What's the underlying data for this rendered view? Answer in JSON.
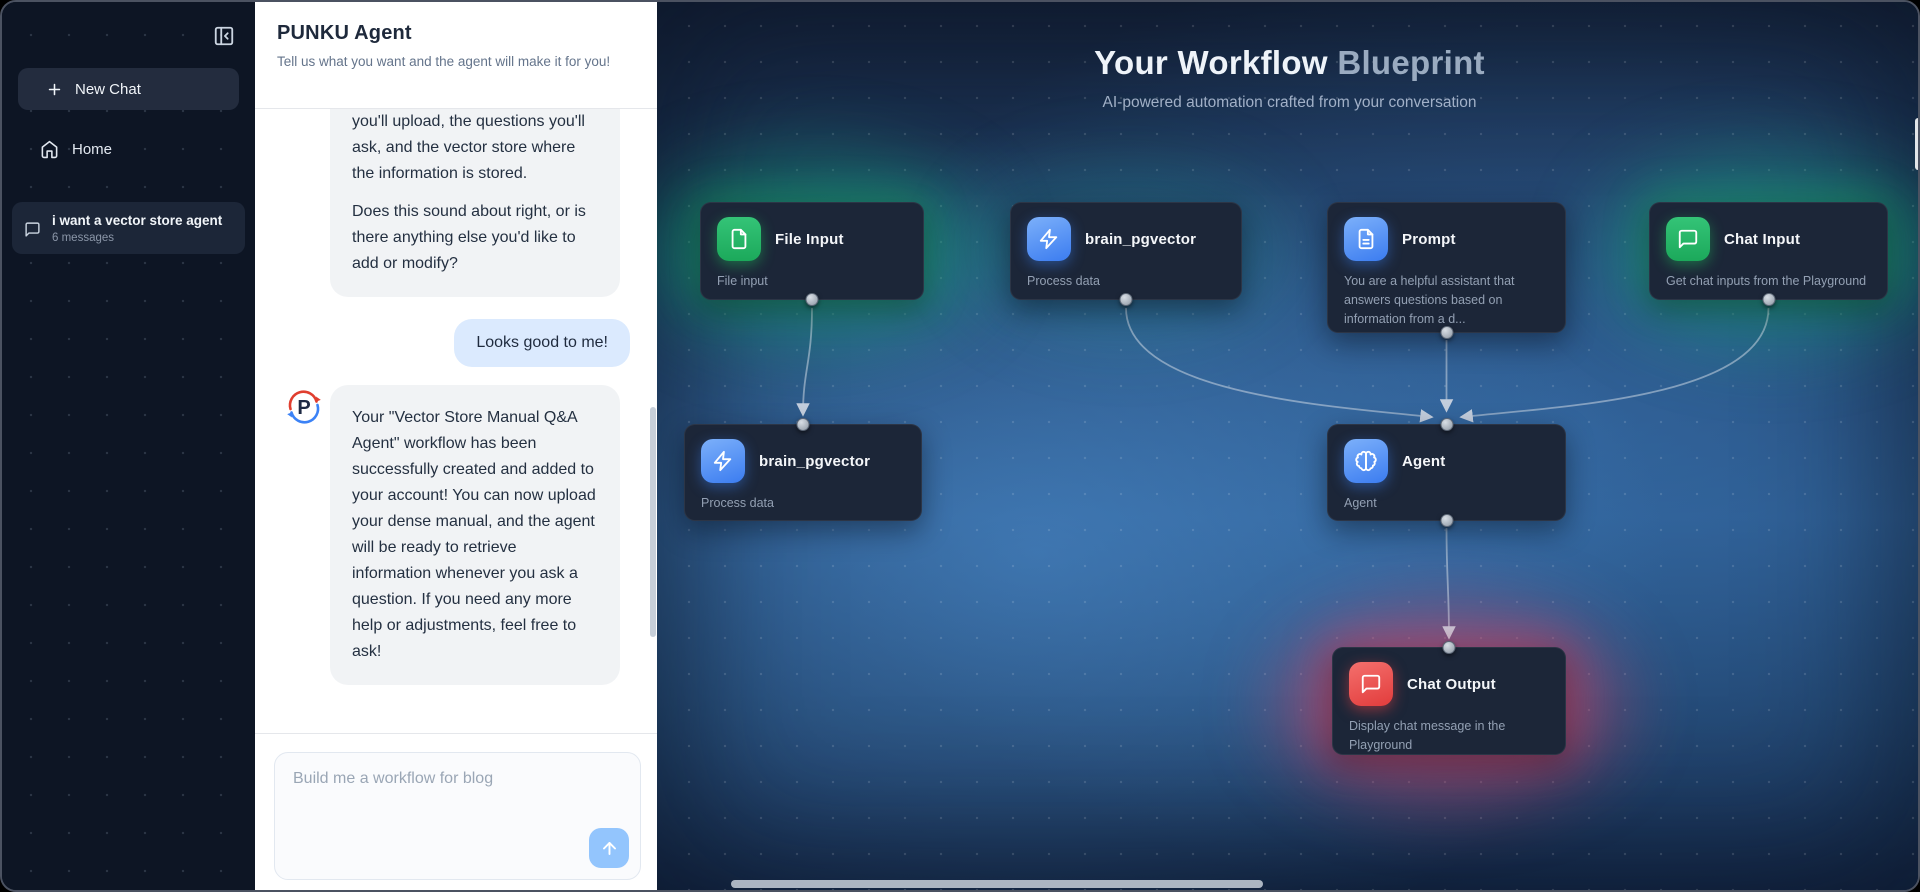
{
  "sidebar": {
    "new_chat_label": "New Chat",
    "home_label": "Home",
    "history": {
      "title": "i want a vector store agent",
      "subtitle": "6 messages"
    }
  },
  "chat": {
    "title": "PUNKU Agent",
    "subtitle": "Tell us what you want and the agent will make it for you!",
    "messages": [
      {
        "role": "agent",
        "paragraphs": [
          "you'll upload, the questions you'll ask, and the vector store where the information is stored.",
          "Does this sound about right, or is there anything else you'd like to add or modify?"
        ]
      },
      {
        "role": "user",
        "text": "Looks good to me!"
      },
      {
        "role": "agent",
        "text": "Your \"Vector Store Manual Q&A Agent\" workflow has been successfully created and added to your account! You can now upload your dense manual, and the agent will be ready to retrieve information whenever you ask a question. If you need any more help or adjustments, feel free to ask!"
      }
    ],
    "input_placeholder": "Build me a workflow for blog"
  },
  "canvas": {
    "title_primary": "Your Workflow",
    "title_accent": "Blueprint",
    "subtitle": "AI-powered automation crafted from your conversation",
    "nodes": [
      {
        "title": "File Input",
        "desc": "File input",
        "icon": "file-icon",
        "color": "green"
      },
      {
        "title": "brain_pgvector",
        "desc": "Process data",
        "icon": "zap-icon",
        "color": "blue"
      },
      {
        "title": "Prompt",
        "desc": "You are a helpful assistant that answers questions based on information from a d...",
        "icon": "file-text-icon",
        "color": "blue"
      },
      {
        "title": "Chat Input",
        "desc": "Get chat inputs from the Playground",
        "icon": "chat-bubble-icon",
        "color": "green"
      },
      {
        "title": "brain_pgvector",
        "desc": "Process data",
        "icon": "zap-icon",
        "color": "blue"
      },
      {
        "title": "Agent",
        "desc": "Agent",
        "icon": "brain-icon",
        "color": "blue"
      },
      {
        "title": "Chat Output",
        "desc": "Display chat message in the Playground",
        "icon": "chat-bubble-icon",
        "color": "red"
      }
    ]
  },
  "colors": {
    "accent_green": "#2fbe6e",
    "accent_blue": "#4f8df7",
    "accent_red": "#ef4444",
    "canvas_blue": "#2a5586",
    "user_bubble": "#dbeafe",
    "agent_bubble": "#f1f3f5"
  }
}
